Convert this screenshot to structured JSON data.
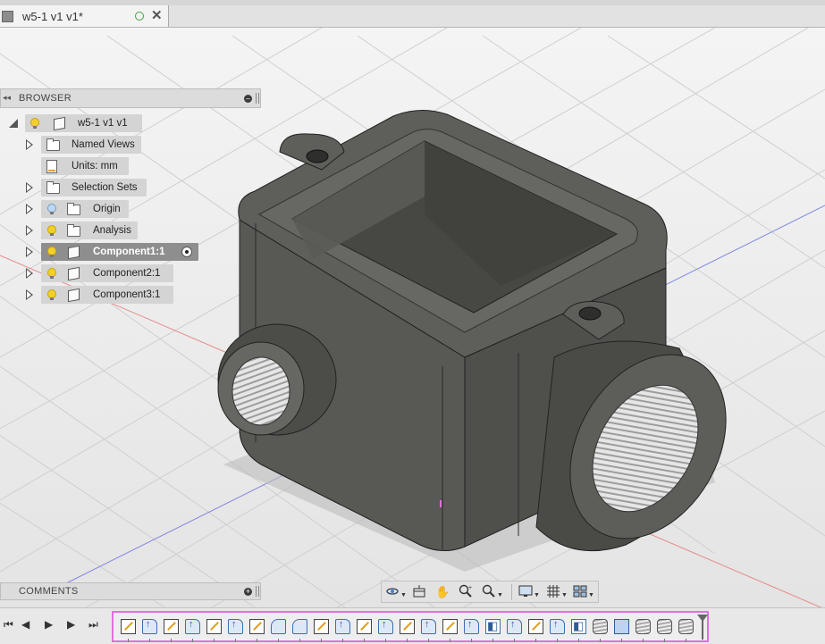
{
  "document": {
    "tab_title": "w5-1 v1 v1*",
    "close_label": "✕"
  },
  "browser": {
    "header": "BROWSER",
    "collapse_label": "◂◂",
    "minimize_label": "–",
    "root": "w5-1 v1 v1",
    "items": [
      {
        "label": "Named Views"
      },
      {
        "label": "Units: mm"
      },
      {
        "label": "Selection Sets"
      },
      {
        "label": "Origin"
      },
      {
        "label": "Analysis"
      },
      {
        "label": "Component1:1",
        "active": true
      },
      {
        "label": "Component2:1"
      },
      {
        "label": "Component3:1"
      }
    ]
  },
  "comments": {
    "header": "COMMENTS",
    "add_label": "+"
  },
  "navigation_bar": {
    "orbit_icon": "orbit-icon",
    "look_at_icon": "look-at-icon",
    "pan_label": "✋",
    "zoom_label": "🔍",
    "display_icon": "display-settings-icon",
    "grid_icon": "grid-settings-icon",
    "viewports_icon": "viewports-icon"
  },
  "timeline": {
    "controls": [
      "⏮",
      "◀",
      "▶",
      "▶",
      "⏭"
    ],
    "features": [
      "sketch",
      "extrude",
      "sketch",
      "extrude",
      "sketch",
      "extrude",
      "sketch",
      "fillet",
      "fillet",
      "sketch",
      "extrude",
      "sketch",
      "extrude",
      "sketch",
      "extrude",
      "sketch",
      "extrude",
      "mirror",
      "extrude",
      "sketch",
      "extrude",
      "mirror",
      "thread",
      "box",
      "thread",
      "thread",
      "thread"
    ]
  },
  "colors": {
    "body": "#5b5b57",
    "selection_outline": "#e070e0",
    "x_axis": "#e05050",
    "z_axis": "#5060e0"
  }
}
